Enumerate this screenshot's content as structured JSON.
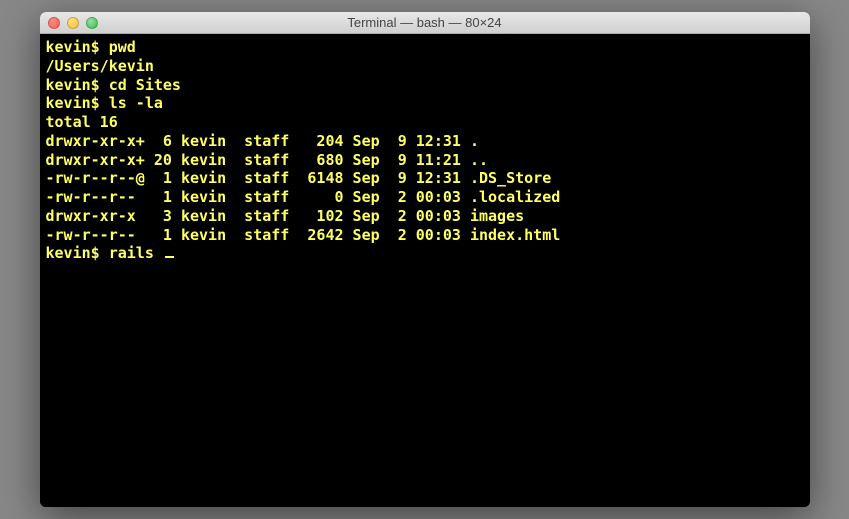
{
  "window": {
    "title": "Terminal — bash — 80×24"
  },
  "session": {
    "prompt": "kevin$",
    "lines": [
      {
        "type": "cmd",
        "prompt": "kevin$",
        "text": " pwd"
      },
      {
        "type": "out",
        "text": "/Users/kevin"
      },
      {
        "type": "cmd",
        "prompt": "kevin$",
        "text": " cd Sites"
      },
      {
        "type": "cmd",
        "prompt": "kevin$",
        "text": " ls -la"
      },
      {
        "type": "out",
        "text": "total 16"
      },
      {
        "type": "out",
        "text": "drwxr-xr-x+  6 kevin  staff   204 Sep  9 12:31 ."
      },
      {
        "type": "out",
        "text": "drwxr-xr-x+ 20 kevin  staff   680 Sep  9 11:21 .."
      },
      {
        "type": "out",
        "text": "-rw-r--r--@  1 kevin  staff  6148 Sep  9 12:31 .DS_Store"
      },
      {
        "type": "out",
        "text": "-rw-r--r--   1 kevin  staff     0 Sep  2 00:03 .localized"
      },
      {
        "type": "out",
        "text": "drwxr-xr-x   3 kevin  staff   102 Sep  2 00:03 images"
      },
      {
        "type": "out",
        "text": "-rw-r--r--   1 kevin  staff  2642 Sep  2 00:03 index.html"
      }
    ],
    "current": {
      "prompt": "kevin$",
      "text": " rails "
    }
  }
}
